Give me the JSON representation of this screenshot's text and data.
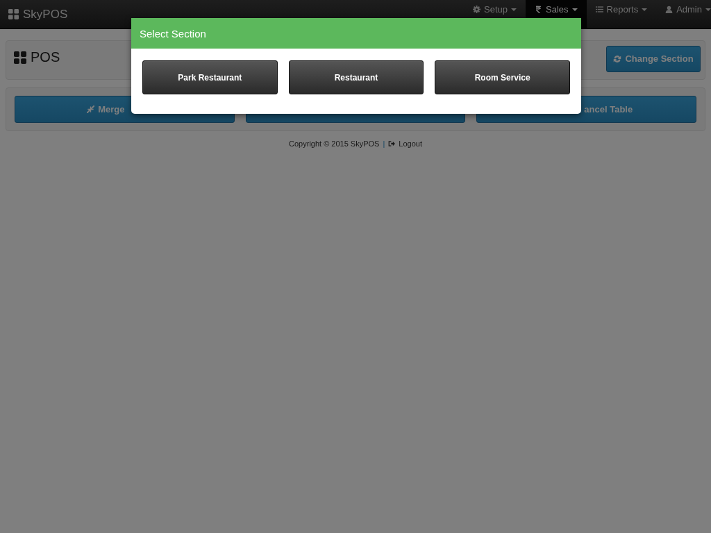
{
  "navbar": {
    "brand": "SkyPOS",
    "items": [
      {
        "label": "Setup",
        "selected": false
      },
      {
        "label": "Sales",
        "selected": true
      },
      {
        "label": "Reports",
        "selected": false
      },
      {
        "label": "Admin",
        "selected": false
      }
    ]
  },
  "page_header": {
    "title": "POS",
    "button": "Change Section"
  },
  "action_buttons": [
    {
      "kind": "labeled",
      "label": "Merge"
    },
    {
      "kind": "blank"
    },
    {
      "kind": "labeled",
      "label": "ancel Table"
    }
  ],
  "footer": {
    "copyright": "Copyright © 2015 SkyPOS",
    "separator": "|",
    "link": "Logout"
  },
  "modal": {
    "title": "Select Section",
    "sections": [
      "Park Restaurant",
      "Restaurant",
      "Room Service"
    ]
  }
}
